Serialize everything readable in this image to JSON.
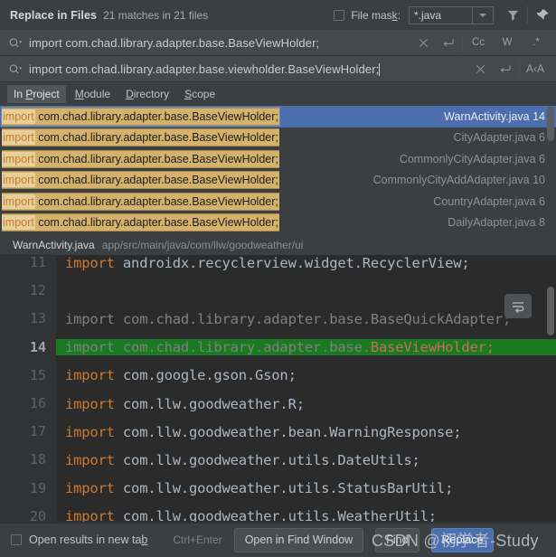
{
  "header": {
    "title": "Replace in Files",
    "subtitle": "21 matches in 21 files",
    "file_mask_label": "File mask:",
    "file_mask_value": "*.java",
    "filter_icon": "funnel-icon",
    "pin_icon": "pin-icon",
    "file_mask_checked": false
  },
  "search": {
    "find_value": "import com.chad.library.adapter.base.BaseViewHolder;",
    "replace_value": "import com.chad.library.adapter.base.viewholder.BaseViewHolder;",
    "find_icon": "search-dropdown-icon",
    "replace_icon": "search-dropdown-icon",
    "clear_icon": "close-icon",
    "history_icon": "history-return-icon",
    "match_case_label": "Cc",
    "words_label": "W",
    "regex_label": ".*",
    "preserve_case_label": "A‹A"
  },
  "scopes": {
    "items": [
      {
        "label": "In Project",
        "mnemonic": "P",
        "active": true
      },
      {
        "label": "Module",
        "mnemonic": "M",
        "active": false
      },
      {
        "label": "Directory",
        "mnemonic": "D",
        "active": false
      },
      {
        "label": "Scope",
        "mnemonic": "S",
        "active": false
      }
    ]
  },
  "results": {
    "rows": [
      {
        "keyword": "import",
        "rest": " com.chad.library.adapter.base.BaseViewHolder;",
        "file": "WarnActivity.java 14",
        "selected": true
      },
      {
        "keyword": "import",
        "rest": " com.chad.library.adapter.base.BaseViewHolder;",
        "file": "CityAdapter.java 6",
        "selected": false
      },
      {
        "keyword": "import",
        "rest": " com.chad.library.adapter.base.BaseViewHolder;",
        "file": "CommonlyCityAdapter.java 6",
        "selected": false
      },
      {
        "keyword": "import",
        "rest": " com.chad.library.adapter.base.BaseViewHolder;",
        "file": "CommonlyCityAddAdapter.java 10",
        "selected": false
      },
      {
        "keyword": "import",
        "rest": " com.chad.library.adapter.base.BaseViewHolder;",
        "file": "CountryAdapter.java 6",
        "selected": false
      },
      {
        "keyword": "import",
        "rest": " com.chad.library.adapter.base.BaseViewHolder;",
        "file": "DailyAdapter.java 8",
        "selected": false
      }
    ]
  },
  "path_bar": {
    "file_name": "WarnActivity.java",
    "directory": "app/src/main/java/com/llw/goodweather/ui"
  },
  "preview": {
    "wrap_icon": "soft-wrap-icon",
    "lines": [
      {
        "num": "11",
        "kw": "import",
        "rest": " androidx.recyclerview.widget.RecyclerView;",
        "style": "normal",
        "highlight": false,
        "current": false
      },
      {
        "num": "12",
        "kw": "",
        "rest": "",
        "style": "normal",
        "highlight": false,
        "current": false
      },
      {
        "num": "13",
        "kw": "import",
        "rest": " com.chad.library.adapter.base.BaseQuickAdapter;",
        "style": "dim",
        "highlight": false,
        "current": false
      },
      {
        "num": "14",
        "kw": "import",
        "rest": " com.chad.library.adapter.base.",
        "tail": "BaseViewHolder;",
        "style": "dim",
        "highlight": true,
        "current": true
      },
      {
        "num": "15",
        "kw": "import",
        "rest": " com.google.gson.Gson;",
        "style": "normal",
        "highlight": false,
        "current": false
      },
      {
        "num": "16",
        "kw": "import",
        "rest": " com.llw.goodweather.R;",
        "style": "normal",
        "highlight": false,
        "current": false
      },
      {
        "num": "17",
        "kw": "import",
        "rest": " com.llw.goodweather.bean.WarningResponse;",
        "style": "normal",
        "highlight": false,
        "current": false
      },
      {
        "num": "18",
        "kw": "import",
        "rest": " com.llw.goodweather.utils.DateUtils;",
        "style": "normal",
        "highlight": false,
        "current": false
      },
      {
        "num": "19",
        "kw": "import",
        "rest": " com.llw.goodweather.utils.StatusBarUtil;",
        "style": "normal",
        "highlight": false,
        "current": false
      },
      {
        "num": "20",
        "kw": "import",
        "rest": " com.llw.goodweather.utils.WeatherUtil;",
        "style": "normal",
        "highlight": false,
        "current": false
      }
    ]
  },
  "footer": {
    "open_new_tab_label": "Open results in new tab",
    "open_new_tab_checked": false,
    "shortcut": "Ctrl+Enter",
    "find_window_button": "Open in Find Window",
    "find_button": "Find",
    "replace_button": "Replace",
    "watermark": "CSDN @初学者-Study"
  },
  "colors": {
    "background": "#3c3f41",
    "editor_background": "#2b2b2b",
    "selection_blue": "#4b6eaf",
    "match_highlight": "#d5b26c",
    "current_match_green": "#1a7a22",
    "keyword_orange": "#cc7832"
  }
}
